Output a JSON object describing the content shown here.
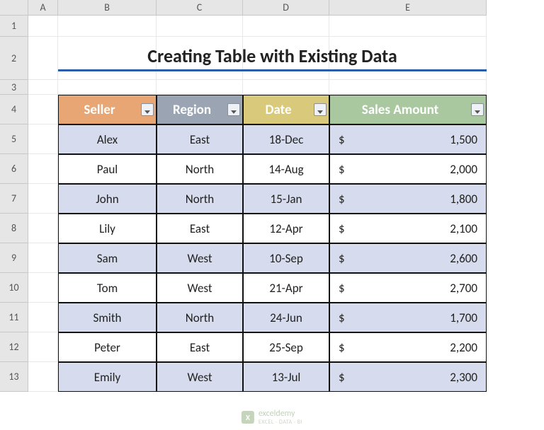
{
  "columns": [
    "A",
    "B",
    "C",
    "D",
    "E"
  ],
  "rows": [
    "1",
    "2",
    "3",
    "4",
    "5",
    "6",
    "7",
    "8",
    "9",
    "10",
    "11",
    "12",
    "13"
  ],
  "title": "Creating Table with Existing Data",
  "headers": {
    "seller": "Seller",
    "region": "Region",
    "date": "Date",
    "amount": "Sales Amount"
  },
  "currency": "$",
  "data": [
    {
      "seller": "Alex",
      "region": "East",
      "date": "18-Dec",
      "amount": "1,500"
    },
    {
      "seller": "Paul",
      "region": "North",
      "date": "14-Aug",
      "amount": "2,000"
    },
    {
      "seller": "John",
      "region": "North",
      "date": "15-Jan",
      "amount": "1,800"
    },
    {
      "seller": "Lily",
      "region": "East",
      "date": "12-Apr",
      "amount": "2,100"
    },
    {
      "seller": "Sam",
      "region": "West",
      "date": "10-Sep",
      "amount": "2,600"
    },
    {
      "seller": "Tom",
      "region": "West",
      "date": "21-Apr",
      "amount": "2,700"
    },
    {
      "seller": "Smith",
      "region": "North",
      "date": "24-Jun",
      "amount": "1,700"
    },
    {
      "seller": "Peter",
      "region": "East",
      "date": "25-Sep",
      "amount": "2,200"
    },
    {
      "seller": "Emily",
      "region": "West",
      "date": "13-Jul",
      "amount": "2,300"
    }
  ],
  "watermark": {
    "brand": "exceldemy",
    "tag": "EXCEL · DATA · BI"
  }
}
